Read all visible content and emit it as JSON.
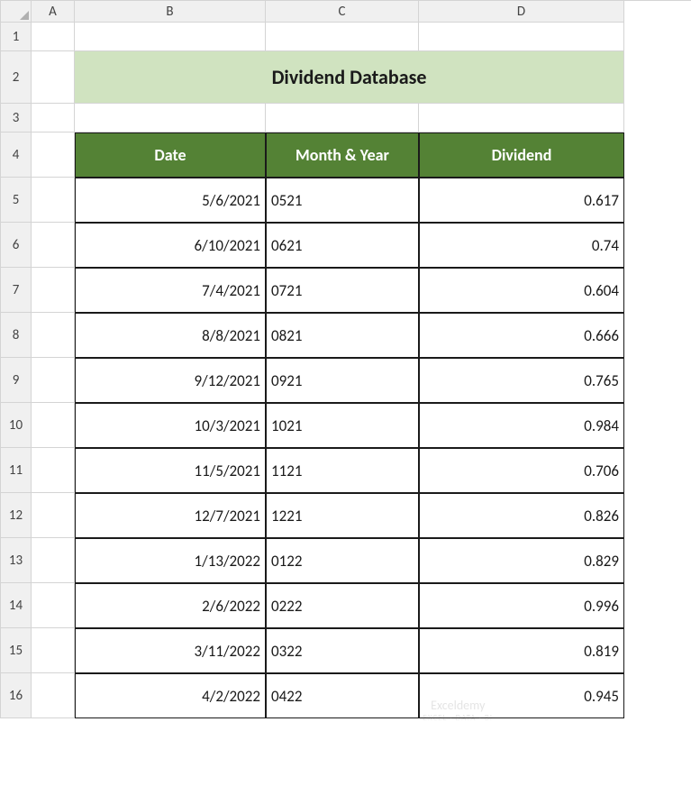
{
  "columns": [
    "",
    "A",
    "B",
    "C",
    "D"
  ],
  "rowNumbers": [
    "1",
    "2",
    "3",
    "4",
    "5",
    "6",
    "7",
    "8",
    "9",
    "10",
    "11",
    "12",
    "13",
    "14",
    "15",
    "16"
  ],
  "title": "Dividend Database",
  "headers": {
    "date": "Date",
    "monthYear": "Month & Year",
    "dividend": "Dividend"
  },
  "rows": [
    {
      "date": "5/6/2021",
      "monthYear": "0521",
      "dividend": "0.617"
    },
    {
      "date": "6/10/2021",
      "monthYear": "0621",
      "dividend": "0.74"
    },
    {
      "date": "7/4/2021",
      "monthYear": "0721",
      "dividend": "0.604"
    },
    {
      "date": "8/8/2021",
      "monthYear": "0821",
      "dividend": "0.666"
    },
    {
      "date": "9/12/2021",
      "monthYear": "0921",
      "dividend": "0.765"
    },
    {
      "date": "10/3/2021",
      "monthYear": "1021",
      "dividend": "0.984"
    },
    {
      "date": "11/5/2021",
      "monthYear": "1121",
      "dividend": "0.706"
    },
    {
      "date": "12/7/2021",
      "monthYear": "1221",
      "dividend": "0.826"
    },
    {
      "date": "1/13/2022",
      "monthYear": "0122",
      "dividend": "0.829"
    },
    {
      "date": "2/6/2022",
      "monthYear": "0222",
      "dividend": "0.996"
    },
    {
      "date": "3/11/2022",
      "monthYear": "0322",
      "dividend": "0.819"
    },
    {
      "date": "4/2/2022",
      "monthYear": "0422",
      "dividend": "0.945"
    }
  ],
  "watermark": {
    "main": "Exceldemy",
    "sub": "EXCEL · DATA · BI"
  }
}
